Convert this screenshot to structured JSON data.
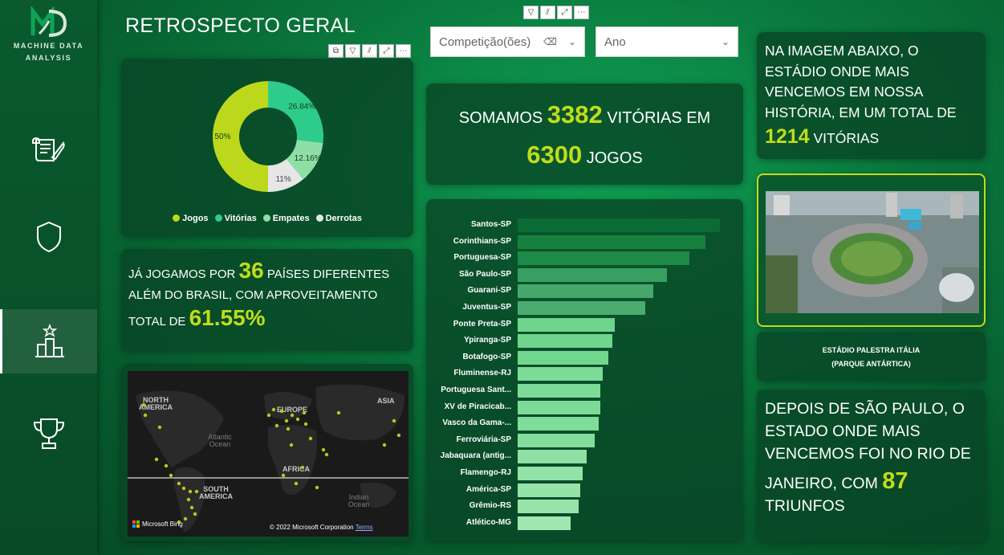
{
  "sidebar": {
    "logo_text_1": "MACHINE DATA",
    "logo_text_2": "ANALYSIS",
    "items": [
      {
        "icon": "scroll-icon"
      },
      {
        "icon": "shield-icon"
      },
      {
        "icon": "podium-icon"
      },
      {
        "icon": "trophy-icon"
      }
    ]
  },
  "title": "RETROSPECTO GERAL",
  "filters": {
    "competicao": "Competição(ões)",
    "ano": "Ano"
  },
  "donut": {
    "segments": [
      {
        "name": "Jogos",
        "pct": "50%",
        "value": 50,
        "color": "#bcd81c"
      },
      {
        "name": "Vitórias",
        "pct": "26.84%",
        "value": 26.84,
        "color": "#2ecc8a"
      },
      {
        "name": "Empates",
        "pct": "12.16%",
        "value": 12.16,
        "color": "#8edfa6"
      },
      {
        "name": "Derrotas",
        "pct": "11%",
        "value": 11,
        "color": "#e6e6e6"
      }
    ]
  },
  "paises": {
    "t1": "JÁ JOGAMOS POR",
    "num": "36",
    "t2": "PAÍSES DIFERENTES",
    "t3": "ALÉM DO BRASIL, COM APROVEITAMENTO",
    "t4": "TOTAL DE",
    "pct": "61.55%"
  },
  "map": {
    "na": "NORTH\nAMERICA",
    "eu": "EUROPE",
    "asia": "ASIA",
    "africa": "AFRICA",
    "sa": "SOUTH\nAMERICA",
    "atl": "Atlantic\nOcean",
    "ind": "Indian\nOcean",
    "bing": "Microsoft Bing",
    "copyright": "© 2022 Microsoft Corporation",
    "terms": "Terms"
  },
  "somamos": {
    "t1": "SOMAMOS",
    "vitorias": "3382",
    "t2": "VITÓRIAS EM",
    "jogos": "6300",
    "t3": "JOGOS"
  },
  "bar_chart": {
    "items": [
      {
        "label": "Santos-SP",
        "value": 100,
        "color": "#0a6b35"
      },
      {
        "label": "Corinthians-SP",
        "value": 93,
        "color": "#16813f"
      },
      {
        "label": "Portuguesa-SP",
        "value": 85,
        "color": "#1e8a48"
      },
      {
        "label": "São Paulo-SP",
        "value": 74,
        "color": "#37a060"
      },
      {
        "label": "Guarani-SP",
        "value": 67,
        "color": "#45a86a"
      },
      {
        "label": "Juventus-SP",
        "value": 63,
        "color": "#4aac6e"
      },
      {
        "label": "Ponte Preta-SP",
        "value": 48,
        "color": "#6fd58c"
      },
      {
        "label": "Ypiranga-SP",
        "value": 47,
        "color": "#6fd58c"
      },
      {
        "label": "Botafogo-SP",
        "value": 45,
        "color": "#72d78e"
      },
      {
        "label": "Fluminense-RJ",
        "value": 42,
        "color": "#7cdb96"
      },
      {
        "label": "Portuguesa Sant...",
        "value": 41,
        "color": "#7edb97"
      },
      {
        "label": "XV de Piracicab...",
        "value": 41,
        "color": "#7edb97"
      },
      {
        "label": "Vasco da Gama-...",
        "value": 40,
        "color": "#80dc99"
      },
      {
        "label": "Ferroviária-SP",
        "value": 38,
        "color": "#85dd9c"
      },
      {
        "label": "Jabaquara (antig...",
        "value": 34,
        "color": "#8ee0a4"
      },
      {
        "label": "Flamengo-RJ",
        "value": 32,
        "color": "#93e2a7"
      },
      {
        "label": "América-SP",
        "value": 31,
        "color": "#95e3a9"
      },
      {
        "label": "Grêmio-RS",
        "value": 30,
        "color": "#97e4ab"
      },
      {
        "label": "Atlético-MG",
        "value": 26,
        "color": "#9fe7b1"
      }
    ]
  },
  "estadio": {
    "t1": "NA IMAGEM ABAIXO, O",
    "t2": "ESTÁDIO ONDE MAIS",
    "t3": "VENCEMOS EM NOSSA",
    "t4": "HISTÓRIA, EM UM TOTAL DE",
    "num": "1214",
    "t5": "VITÓRIAS",
    "nome1": "ESTÁDIO PALESTRA ITÁLIA",
    "nome2": "(PARQUE ANTÁRTICA)"
  },
  "estado": {
    "t1": "DEPOIS DE SÃO PAULO, O",
    "t2": "ESTADO ONDE MAIS",
    "t3": "VENCEMOS FOI NO RIO DE",
    "t4": "JANEIRO, COM",
    "num": "87",
    "t5": "TRIUNFOS"
  },
  "colors": {
    "highlight": "#c0dc1c",
    "card": "#08462a"
  }
}
